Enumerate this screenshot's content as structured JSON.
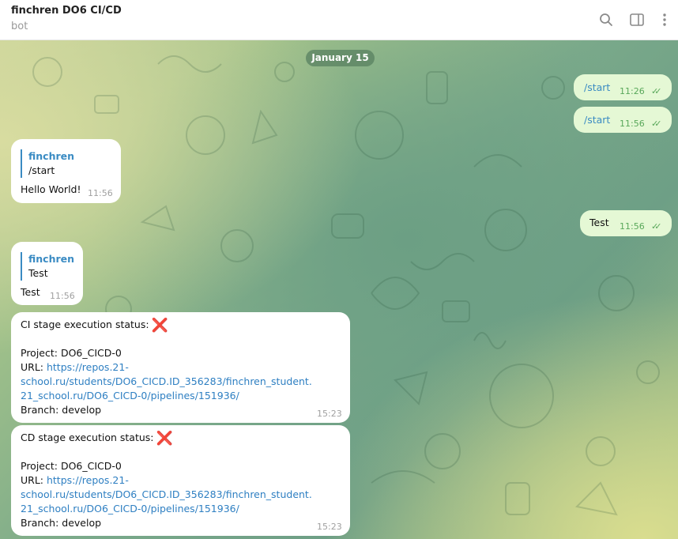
{
  "header": {
    "title": "finchren DO6 CI/CD",
    "subtitle": "bot",
    "icons": [
      "search-icon",
      "sidebar-toggle-icon",
      "more-vertical-icon"
    ]
  },
  "date_separator": "January 15",
  "messages": {
    "out_start_1": {
      "text": "/start",
      "time": "11:26"
    },
    "out_start_2": {
      "text": "/start",
      "time": "11:56"
    },
    "in_hello": {
      "reply_name": "finchren",
      "reply_text": "/start",
      "text": "Hello World!",
      "time": "11:56"
    },
    "out_test": {
      "text": "Test",
      "time": "11:56"
    },
    "in_test": {
      "reply_name": "finchren",
      "reply_text": "Test",
      "text": "Test",
      "time": "11:56"
    },
    "ci_status": {
      "heading": "CI stage execution status:",
      "status_icon": "❌",
      "project": "Project: DO6_CICD-0",
      "url_label": "URL: ",
      "url_line1": "https://repos.21-",
      "url_line2": "school.ru/students/DO6_CICD.ID_356283/finchren_student.",
      "url_line3": "21_school.ru/DO6_CICD-0/pipelines/151936/",
      "branch": "Branch: develop",
      "time": "15:23"
    },
    "cd_status": {
      "heading": "CD stage execution status:",
      "status_icon": "❌",
      "project": "Project: DO6_CICD-0",
      "url_label": "URL: ",
      "url_line1": "https://repos.21-",
      "url_line2": "school.ru/students/DO6_CICD.ID_356283/finchren_student.",
      "url_line3": "21_school.ru/DO6_CICD-0/pipelines/151936/",
      "branch": "Branch: develop",
      "time": "15:23"
    }
  },
  "colors": {
    "link": "#2e7fc2",
    "outgoing_bubble": "#e5f8d5",
    "read_check": "#59a85a",
    "status_cross": "#e23b3b"
  }
}
